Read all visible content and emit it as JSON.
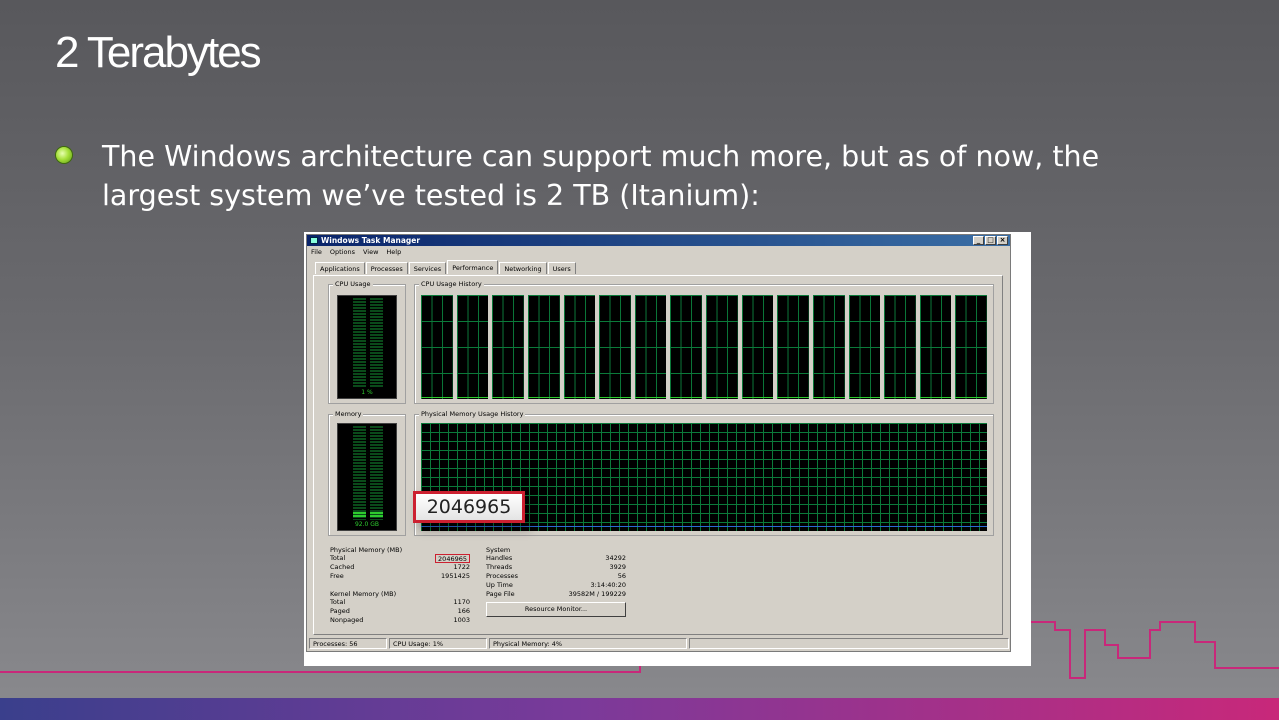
{
  "slide": {
    "title": "2 Terabytes",
    "bullet": "The Windows architecture can support much more, but as of now, the largest system we’ve tested is 2 TB (Itanium):"
  },
  "taskmanager": {
    "title": "Windows Task Manager",
    "menu": [
      "File",
      "Options",
      "View",
      "Help"
    ],
    "tabs": [
      "Applications",
      "Processes",
      "Services",
      "Performance",
      "Networking",
      "Users"
    ],
    "active_tab": "Performance",
    "cpu_usage_label": "CPU Usage",
    "cpu_usage_value": "1 %",
    "cpu_history_label": "CPU Usage History",
    "memory_label": "Memory",
    "memory_value": "92.0 GB",
    "phys_history_label": "Physical Memory Usage History",
    "callout_value": "2046965",
    "physical_memory": {
      "heading": "Physical Memory (MB)",
      "rows": [
        {
          "label": "Total",
          "value": "2046965"
        },
        {
          "label": "Cached",
          "value": "1722"
        },
        {
          "label": "Free",
          "value": "1951425"
        }
      ]
    },
    "kernel_memory": {
      "heading": "Kernel Memory (MB)",
      "rows": [
        {
          "label": "Total",
          "value": "1170"
        },
        {
          "label": "Paged",
          "value": "166"
        },
        {
          "label": "Nonpaged",
          "value": "1003"
        }
      ]
    },
    "system": {
      "heading": "System",
      "rows": [
        {
          "label": "Handles",
          "value": "34292"
        },
        {
          "label": "Threads",
          "value": "3929"
        },
        {
          "label": "Processes",
          "value": "56"
        },
        {
          "label": "Up Time",
          "value": "3:14:40:20"
        },
        {
          "label": "Page File",
          "value": "39582M / 199229"
        }
      ]
    },
    "resource_monitor_button": "Resource Monitor...",
    "status": {
      "processes": "Processes: 56",
      "cpu": "CPU Usage: 1%",
      "physical": "Physical Memory: 4%"
    }
  },
  "colors": {
    "accent_line": "#c8287a",
    "graph_green": "#0b7a3a",
    "highlight_red": "#cc2030"
  }
}
